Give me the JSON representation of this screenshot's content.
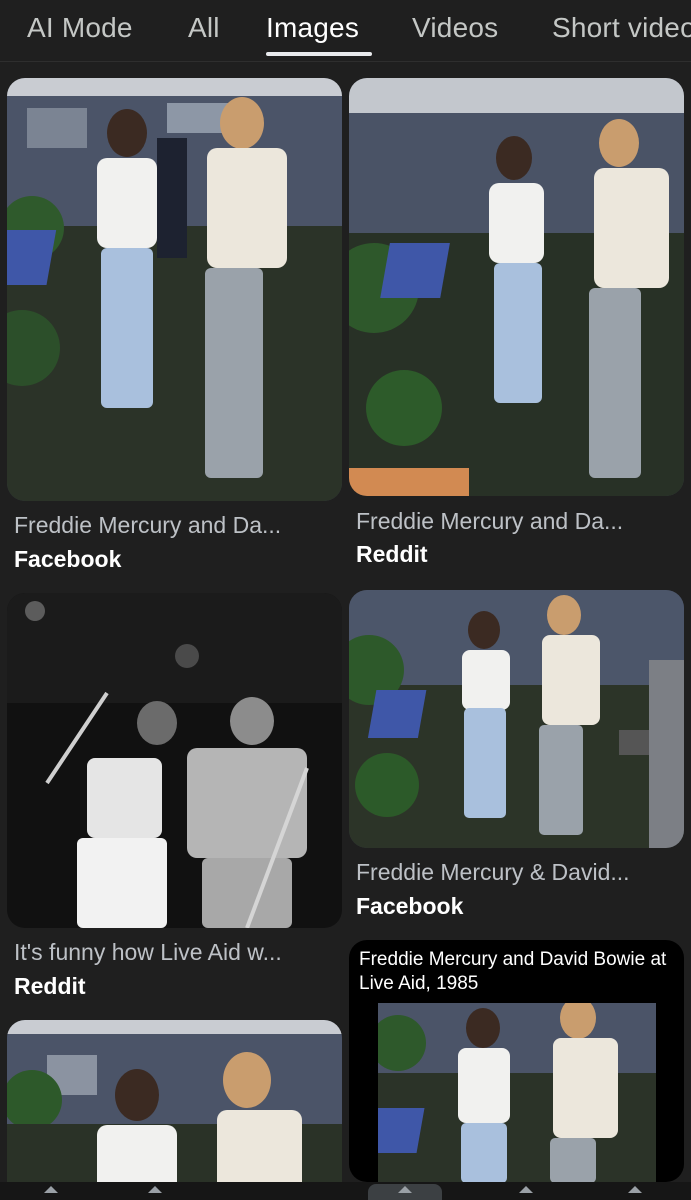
{
  "tabs": [
    {
      "label": "AI Mode",
      "active": false
    },
    {
      "label": "All",
      "active": false
    },
    {
      "label": "Images",
      "active": true
    },
    {
      "label": "Videos",
      "active": false
    },
    {
      "label": "Short videos",
      "active": false
    }
  ],
  "results": [
    {
      "title": "Freddie Mercury and Da...",
      "source": "Facebook",
      "image": "backstage-photo"
    },
    {
      "title": "Freddie Mercury and Da...",
      "source": "Reddit",
      "image": "backstage-photo"
    },
    {
      "title": "It's funny how Live Aid w...",
      "source": "Reddit",
      "image": "stage-performance-photo"
    },
    {
      "title": "Freddie Mercury & David...",
      "source": "Facebook",
      "image": "backstage-photo"
    },
    {
      "title": "",
      "source": "",
      "image": "backstage-photo"
    },
    {
      "title": "",
      "source": "",
      "image": "backstage-photo-with-caption",
      "overlay_text": "Freddie Mercury and David Bowie at Live Aid, 1985"
    }
  ],
  "colors": {
    "background": "#1f1f1f",
    "active_tab": "#ffffff",
    "inactive_tab": "#c4c7c5",
    "caption": "#bdc1c6"
  },
  "bottom_nav": {
    "icons": [
      "home-icon",
      "discover-icon",
      "tabs-icon",
      "notifications-icon",
      "menu-icon"
    ],
    "active_index": 2
  }
}
